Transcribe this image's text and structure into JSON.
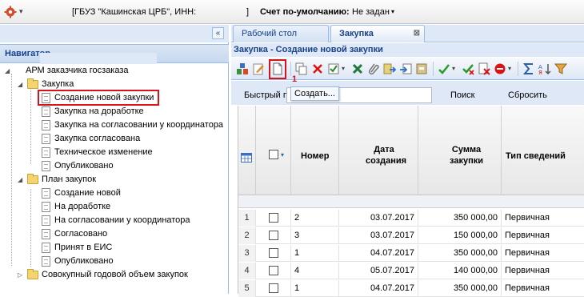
{
  "top_bar": {
    "org_text": "[ГБУЗ \"Кашинская ЦРБ\", ИНН:",
    "org_close": "]",
    "account_label": "Счет по-умолчанию:",
    "account_value": "Не задан",
    "gear_icon": "gear-icon"
  },
  "navigator": {
    "collapse_label": "«",
    "header": "Навигатор",
    "root": "АРМ заказчика госзаказа",
    "groups": [
      {
        "label": "Закупка",
        "items": [
          "Создание новой закупки",
          "Закупка на доработке",
          "Закупка на согласовании у координатора",
          "Закупка согласована",
          "Техническое изменение",
          "Опубликовано"
        ]
      },
      {
        "label": "План закупок",
        "items": [
          "Создание новой",
          "На доработке",
          "На согласовании у координатора",
          "Согласовано",
          "Принят в ЕИС",
          "Опубликовано"
        ]
      },
      {
        "label": "Совокупный годовой объем закупок",
        "items": []
      }
    ]
  },
  "tabs": [
    {
      "label": "Рабочий стол",
      "active": false
    },
    {
      "label": "Закупка",
      "active": true
    }
  ],
  "panel_title": "Закупка - Создание новой закупки",
  "step_marker": "1",
  "tooltip": "Создать...",
  "filter": {
    "label": "Быстрый п",
    "value": "",
    "search": "Поиск",
    "reset": "Сбросить"
  },
  "grid": {
    "headers": {
      "number": "Номер",
      "date_line1": "Дата",
      "date_line2": "создания",
      "sum_line1": "Сумма",
      "sum_line2": "закупки",
      "type": "Тип сведений"
    },
    "rows": [
      {
        "n": "1",
        "number": "2",
        "date": "03.07.2017",
        "sum": "350 000,00",
        "type": "Первичная"
      },
      {
        "n": "2",
        "number": "3",
        "date": "03.07.2017",
        "sum": "150 000,00",
        "type": "Первичная"
      },
      {
        "n": "3",
        "number": "1",
        "date": "04.07.2017",
        "sum": "350 000,00",
        "type": "Первичная"
      },
      {
        "n": "4",
        "number": "4",
        "date": "05.07.2017",
        "sum": "140 000,00",
        "type": "Первичная"
      },
      {
        "n": "5",
        "number": "1",
        "date": "04.07.2017",
        "sum": "350 000,00",
        "type": "Первичная"
      }
    ]
  },
  "colors": {
    "highlight": "#d8121b",
    "header_blue": "#15428b",
    "panel_bg": "#dfe8f6"
  }
}
